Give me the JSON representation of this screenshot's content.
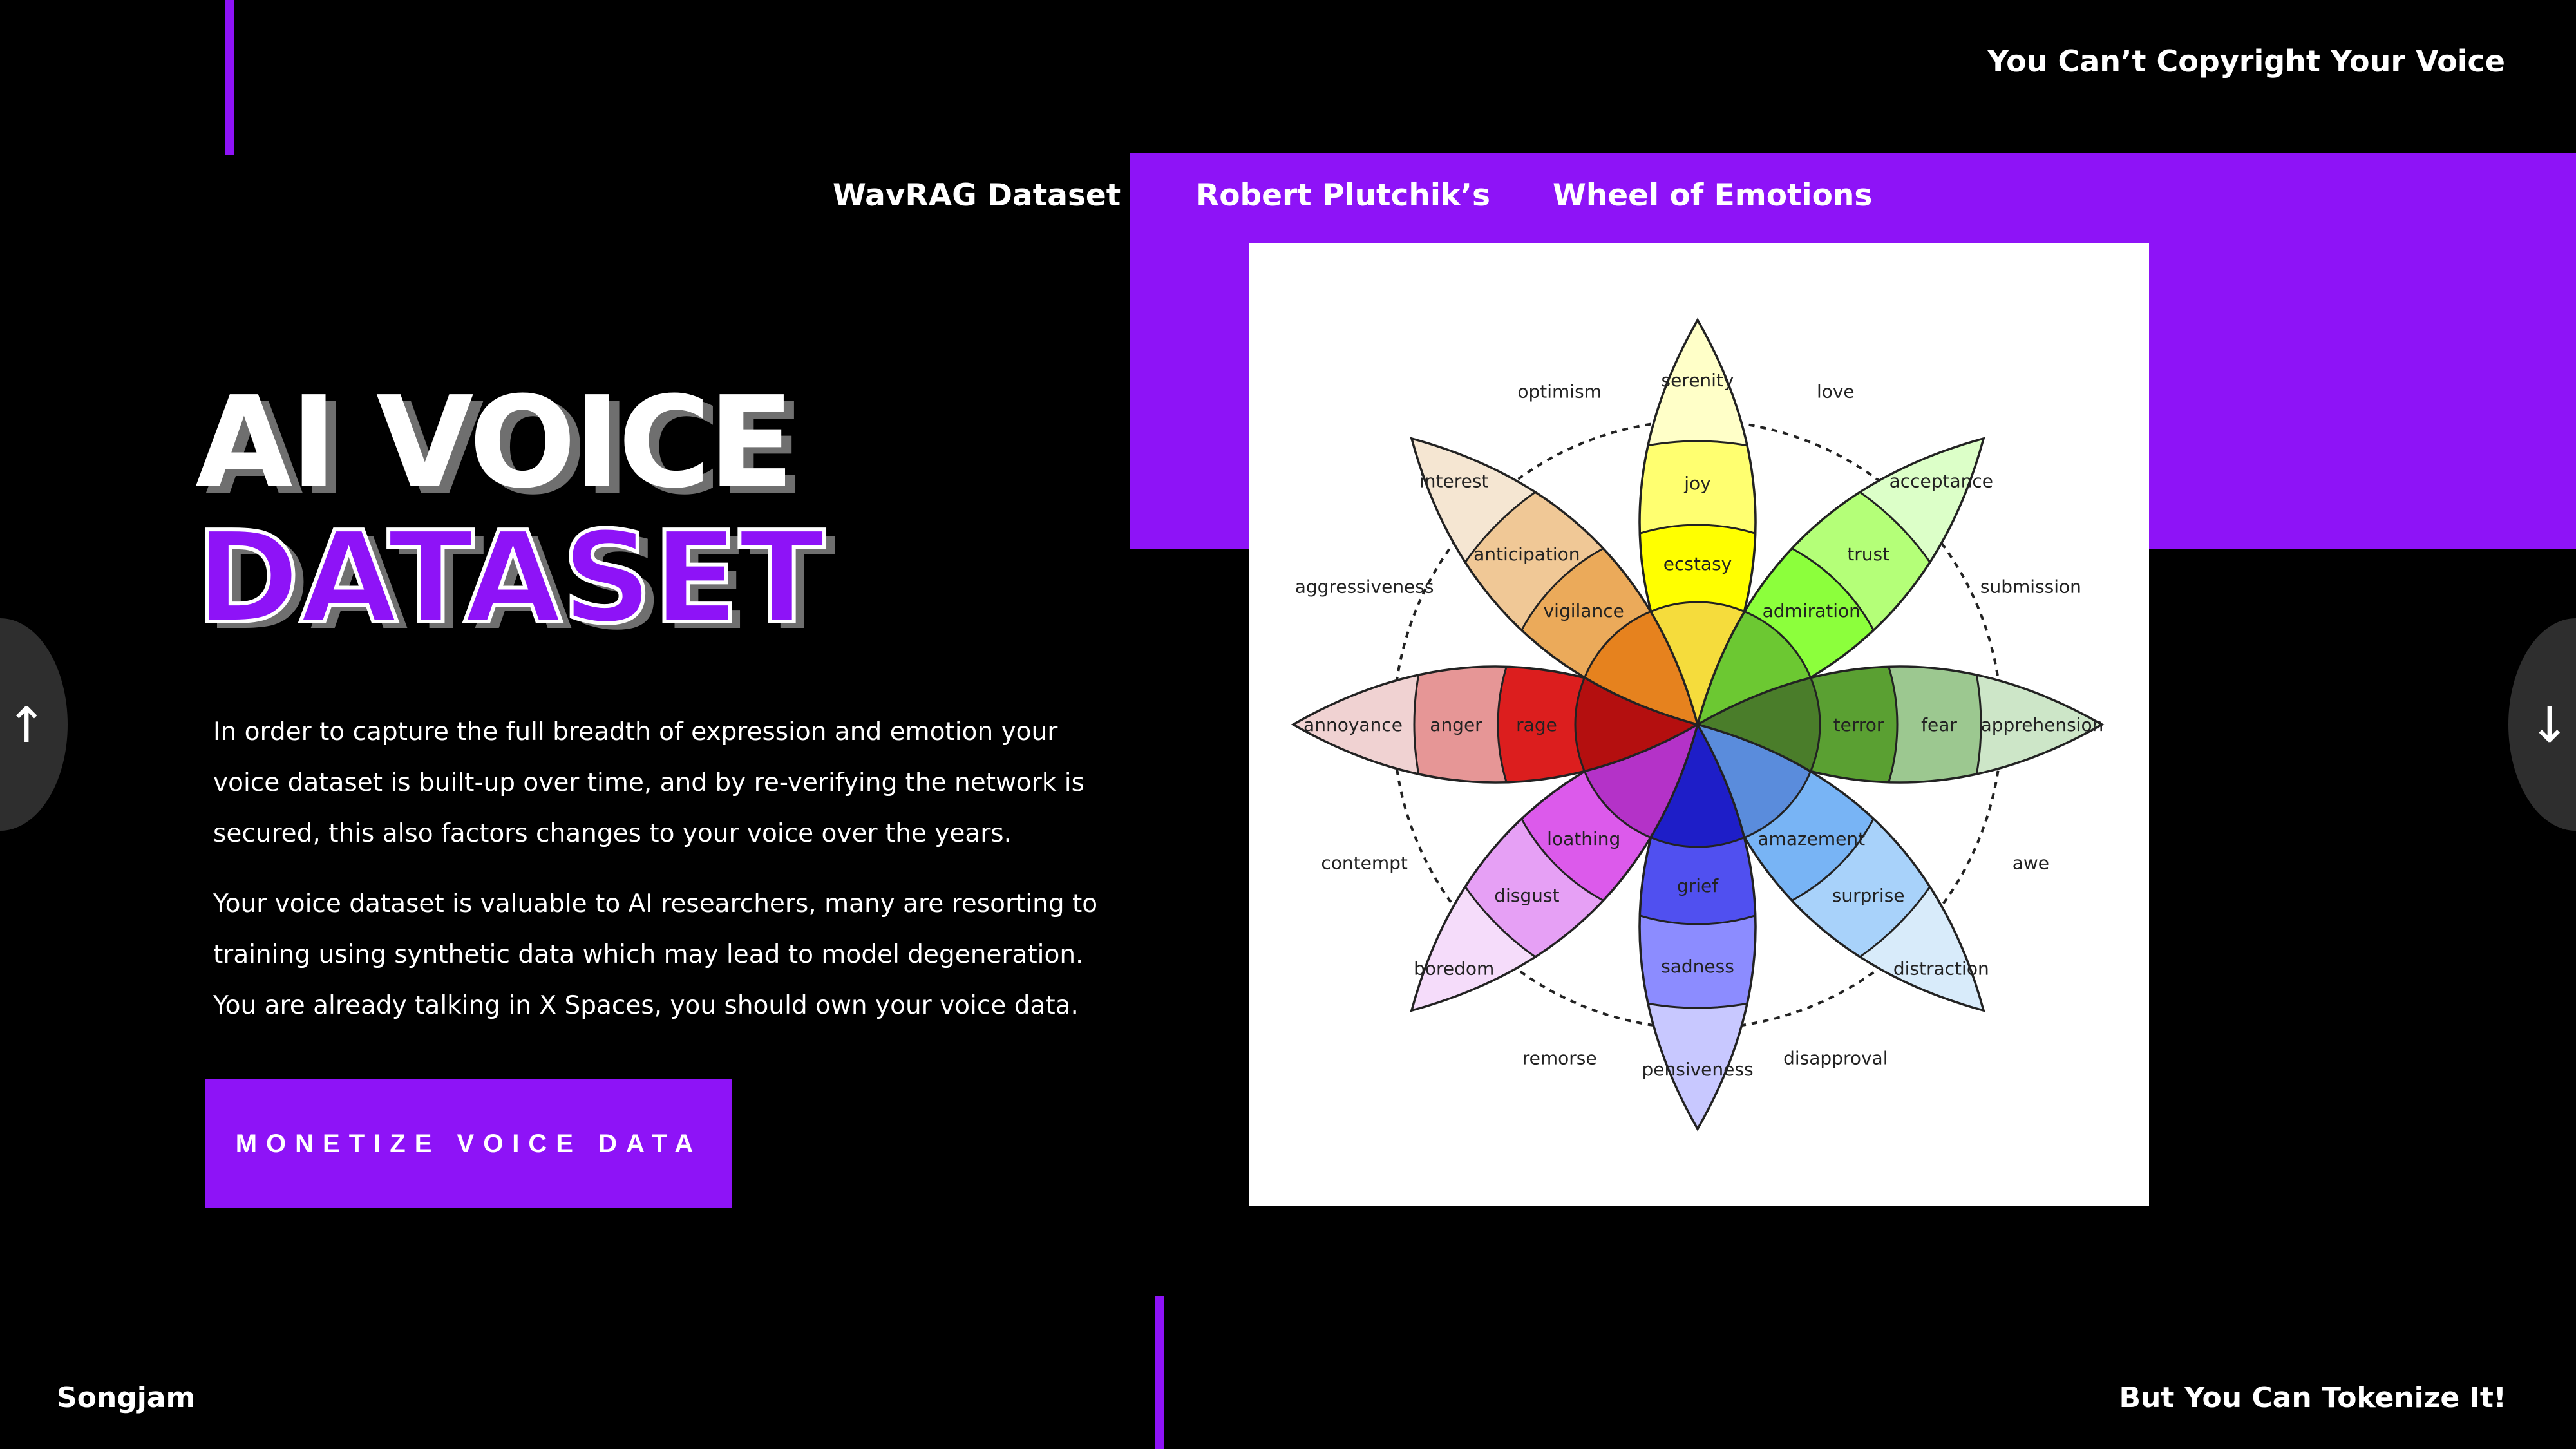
{
  "header": {
    "tagline": "You Can’t Copyright Your Voice"
  },
  "nav": {
    "tabs": [
      {
        "label": "WavRAG Dataset"
      },
      {
        "label": "Robert Plutchik’s"
      },
      {
        "label": "Wheel of Emotions"
      }
    ]
  },
  "hero": {
    "title_line1": "AI VOICE",
    "title_line2": "DATASET",
    "paragraph1": "In order to capture the full breadth of expression and emotion your voice dataset is built-up over time, and by re-verifying the network is secured, this also factors changes to your voice over the years.",
    "paragraph2": "Your voice dataset is valuable to AI researchers, many are resorting to training using synthetic data which may lead to model degeneration. You are already talking in X Spaces, you should own your voice data.",
    "cta_label": "MONETIZE VOICE DATA"
  },
  "navigation": {
    "prev_icon": "↑",
    "next_icon": "↓"
  },
  "footer": {
    "brand": "Songjam",
    "tagline": "But You Can Tokenize It!"
  },
  "colors": {
    "accent": "#8e13f7",
    "background": "#000000",
    "text": "#ffffff"
  },
  "wheel": {
    "petals": [
      {
        "outer": "serenity",
        "middle": "joy",
        "inner": "ecstasy",
        "colors": [
          "#ffffc8",
          "#ffff70",
          "#ffff00",
          "#f5dc3c"
        ]
      },
      {
        "outer": "acceptance",
        "middle": "trust",
        "inner": "admiration",
        "colors": [
          "#dcffc8",
          "#b4ff78",
          "#8cff3c",
          "#6cc832"
        ]
      },
      {
        "outer": "apprehension",
        "middle": "fear",
        "inner": "terror",
        "colors": [
          "#cde6c8",
          "#9cc890",
          "#5aa032",
          "#4a7d2a"
        ]
      },
      {
        "outer": "distraction",
        "middle": "surprise",
        "inner": "amazement",
        "colors": [
          "#d8ebfa",
          "#a8d2fa",
          "#78b4f5",
          "#5a8cdc"
        ]
      },
      {
        "outer": "pensiveness",
        "middle": "sadness",
        "inner": "grief",
        "colors": [
          "#c8c8ff",
          "#8c8cff",
          "#5050f0",
          "#1e1ec8"
        ]
      },
      {
        "outer": "boredom",
        "middle": "disgust",
        "inner": "loathing",
        "colors": [
          "#f5dcfa",
          "#e6a0f5",
          "#dc5aeb",
          "#b432c8"
        ]
      },
      {
        "outer": "annoyance",
        "middle": "anger",
        "inner": "rage",
        "colors": [
          "#f0d2d2",
          "#e69696",
          "#dc1e1e",
          "#b40f0f"
        ]
      },
      {
        "outer": "interest",
        "middle": "anticipation",
        "inner": "vigilance",
        "colors": [
          "#f5e6d2",
          "#f0c896",
          "#ebaa5a",
          "#e6821e"
        ]
      }
    ],
    "dyads": [
      "love",
      "submission",
      "awe",
      "disapproval",
      "remorse",
      "contempt",
      "aggressiveness",
      "optimism"
    ]
  }
}
